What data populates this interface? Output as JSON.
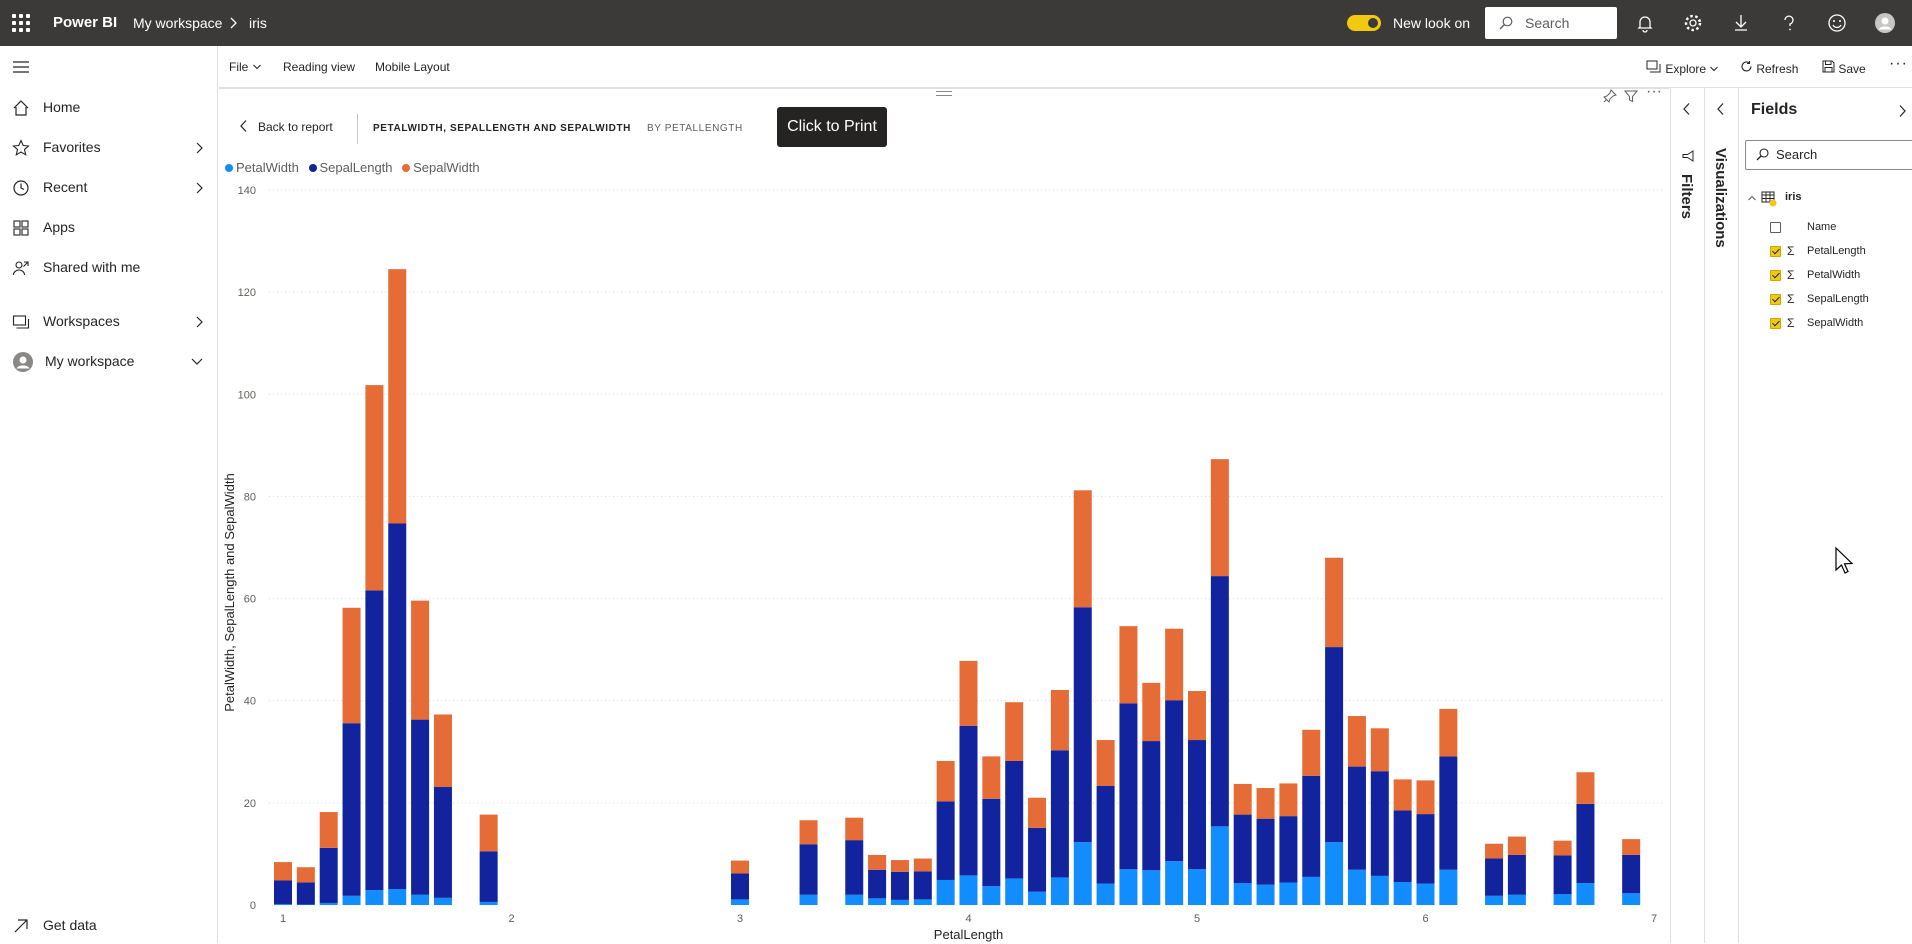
{
  "topbar": {
    "app_name": "Power BI",
    "breadcrumb": [
      "My workspace",
      "iris"
    ],
    "new_look_label": "New look on",
    "search_placeholder": "Search",
    "icons": [
      "waffle-icon",
      "bell-icon",
      "gear-icon",
      "download-icon",
      "help-icon",
      "smiley-icon",
      "avatar-icon"
    ]
  },
  "leftnav": {
    "items": [
      {
        "label": "Home",
        "icon": "home-icon",
        "chevron": ""
      },
      {
        "label": "Favorites",
        "icon": "star-icon",
        "chevron": "right"
      },
      {
        "label": "Recent",
        "icon": "clock-icon",
        "chevron": "right"
      },
      {
        "label": "Apps",
        "icon": "apps-icon",
        "chevron": ""
      },
      {
        "label": "Shared with me",
        "icon": "shared-icon",
        "chevron": ""
      },
      {
        "label": "Workspaces",
        "icon": "workspaces-icon",
        "chevron": "right"
      },
      {
        "label": "My workspace",
        "icon": "avatar-icon",
        "chevron": "down"
      }
    ],
    "get_data_label": "Get data"
  },
  "cmdbar": {
    "file_label": "File",
    "reading_view_label": "Reading view",
    "mobile_layout_label": "Mobile Layout",
    "explore_label": "Explore",
    "refresh_label": "Refresh",
    "save_label": "Save"
  },
  "visual": {
    "back_label": "Back to report",
    "tab_title": "PETALWIDTH, SEPALLENGTH AND SEPALWIDTH",
    "tab_by": "BY PETALLENGTH",
    "print_label": "Click to Print"
  },
  "colors": {
    "PetalWidth": "#118dff",
    "SepalLength": "#12239e",
    "SepalWidth": "#e66c37",
    "accent": "#f2c811"
  },
  "chart_data": {
    "type": "bar",
    "stacked": true,
    "xlabel": "PetalLength",
    "ylabel": "PetalWidth, SepalLength and SepalWidth",
    "xlim": [
      1,
      7
    ],
    "ylim": [
      0,
      140
    ],
    "x_ticks": [
      1,
      2,
      3,
      4,
      5,
      6,
      7
    ],
    "y_ticks": [
      0,
      20,
      40,
      60,
      80,
      100,
      120,
      140
    ],
    "grid": true,
    "legend_position": "top-left",
    "x": [
      1.0,
      1.1,
      1.2,
      1.3,
      1.4,
      1.5,
      1.6,
      1.7,
      1.9,
      3.0,
      3.3,
      3.5,
      3.6,
      3.7,
      3.8,
      3.9,
      4.0,
      4.1,
      4.2,
      4.3,
      4.4,
      4.5,
      4.6,
      4.7,
      4.8,
      4.9,
      5.0,
      5.1,
      5.2,
      5.3,
      5.4,
      5.5,
      5.6,
      5.7,
      5.8,
      5.9,
      6.0,
      6.1,
      6.3,
      6.4,
      6.6,
      6.7,
      6.9
    ],
    "series": [
      {
        "name": "PetalWidth",
        "values": [
          0.2,
          0.1,
          0.4,
          1.8,
          2.9,
          3.1,
          2.0,
          1.4,
          0.6,
          1.1,
          2.0,
          2.0,
          1.3,
          1.0,
          1.1,
          4.9,
          5.8,
          3.7,
          5.2,
          2.6,
          5.4,
          12.3,
          4.2,
          7.0,
          6.8,
          8.6,
          7.0,
          15.4,
          4.3,
          4.0,
          4.4,
          5.5,
          12.3,
          6.9,
          5.7,
          4.5,
          4.2,
          6.9,
          1.8,
          2.0,
          2.1,
          4.3,
          2.3
        ]
      },
      {
        "name": "SepalLength",
        "values": [
          4.6,
          4.3,
          10.8,
          33.8,
          58.7,
          71.6,
          34.3,
          21.7,
          9.9,
          5.1,
          9.9,
          10.7,
          5.6,
          5.5,
          5.5,
          15.4,
          29.3,
          17.1,
          23.0,
          12.5,
          24.9,
          46.0,
          19.1,
          32.5,
          25.3,
          31.5,
          25.3,
          49.0,
          13.4,
          12.9,
          13.0,
          19.8,
          38.2,
          20.2,
          20.5,
          14.0,
          13.6,
          22.2,
          7.3,
          7.8,
          7.6,
          15.5,
          7.5
        ]
      },
      {
        "name": "SepalWidth",
        "values": [
          3.6,
          3.0,
          7.0,
          22.6,
          40.2,
          49.8,
          23.3,
          14.2,
          7.2,
          2.5,
          4.7,
          4.4,
          2.9,
          2.3,
          2.5,
          7.9,
          12.7,
          8.3,
          11.5,
          5.9,
          11.8,
          22.9,
          9.0,
          15.1,
          11.4,
          14.0,
          9.6,
          22.9,
          6.0,
          6.0,
          6.4,
          9.0,
          17.5,
          9.9,
          8.4,
          6.1,
          6.6,
          9.3,
          2.9,
          3.6,
          2.9,
          6.2,
          3.1
        ]
      }
    ]
  },
  "fields": {
    "title": "Fields",
    "search_placeholder": "Search",
    "table_name": "iris",
    "items": [
      {
        "name": "Name",
        "checked": false,
        "sigma": false
      },
      {
        "name": "PetalLength",
        "checked": true,
        "sigma": true
      },
      {
        "name": "PetalWidth",
        "checked": true,
        "sigma": true
      },
      {
        "name": "SepalLength",
        "checked": true,
        "sigma": true
      },
      {
        "name": "SepalWidth",
        "checked": true,
        "sigma": true
      }
    ]
  },
  "panes": {
    "filters_label": "Filters",
    "visualizations_label": "Visualizations"
  }
}
